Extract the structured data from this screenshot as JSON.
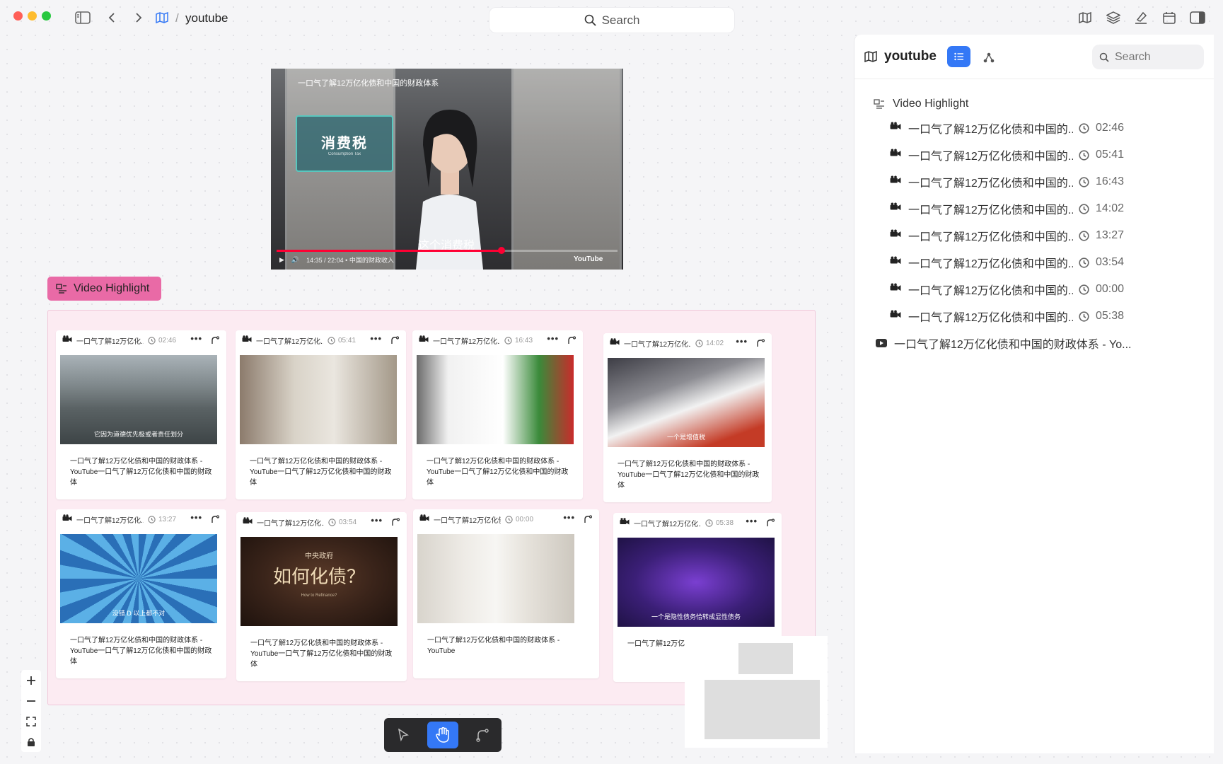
{
  "window": {
    "breadcrumb_sep": "/",
    "title": "youtube",
    "search_placeholder": "Search"
  },
  "panel": {
    "title": "youtube",
    "search_placeholder": "Search",
    "group_label": "Video Highlight",
    "items": [
      {
        "label": "一口气了解12万亿化债和中国的...",
        "time": "02:46"
      },
      {
        "label": "一口气了解12万亿化债和中国的...",
        "time": "05:41"
      },
      {
        "label": "一口气了解12万亿化债和中国的...",
        "time": "16:43"
      },
      {
        "label": "一口气了解12万亿化债和中国的...",
        "time": "14:02"
      },
      {
        "label": "一口气了解12万亿化债和中国的...",
        "time": "13:27"
      },
      {
        "label": "一口气了解12万亿化债和中国的...",
        "time": "03:54"
      },
      {
        "label": "一口气了解12万亿化债和中国的...",
        "time": "00:00"
      },
      {
        "label": "一口气了解12万亿化债和中国的...",
        "time": "05:38"
      }
    ],
    "video_item": "一口气了解12万亿化债和中国的财政体系 - Yo..."
  },
  "player": {
    "title": "一口气了解12万亿化债和中国的财政体系",
    "overlay_big": "消费税",
    "overlay_small": "Consumption Tax",
    "caption": "这个消费税",
    "time_text": "14:35 / 22:04 • 中国的财政收入",
    "progress_fraction": 0.66,
    "brand": "YouTube"
  },
  "section": {
    "label": "Video Highlight"
  },
  "cards": [
    {
      "title": "一口气了解12万亿化...",
      "time": "02:46",
      "caption": "它因为道德优先极或者责任划分",
      "desc": "一口气了解12万亿化债和中国的财政体系 - YouTube一口气了解12万亿化债和中国的财政体"
    },
    {
      "title": "一口气了解12万亿化...",
      "time": "05:41",
      "caption": "",
      "desc": "一口气了解12万亿化债和中国的财政体系 - YouTube一口气了解12万亿化债和中国的财政体"
    },
    {
      "title": "一口气了解12万亿化...",
      "time": "16:43",
      "caption": "",
      "desc": "一口气了解12万亿化债和中国的财政体系 - YouTube一口气了解12万亿化债和中国的财政体"
    },
    {
      "title": "一口气了解12万亿化...",
      "time": "14:02",
      "caption": "一个是增值税",
      "desc": "一口气了解12万亿化债和中国的财政体系 - YouTube一口气了解12万亿化债和中国的财政体"
    },
    {
      "title": "一口气了解12万亿化...",
      "time": "13:27",
      "caption": "没错 D 以上都不对",
      "desc": "一口气了解12万亿化债和中国的财政体系 - YouTube一口气了解12万亿化债和中国的财政体"
    },
    {
      "title": "一口气了解12万亿化...",
      "time": "03:54",
      "caption": "",
      "desc": "一口气了解12万亿化债和中国的财政体系 - YouTube一口气了解12万亿化债和中国的财政体"
    },
    {
      "title": "一口气了解12万亿化债和...",
      "time": "00:00",
      "caption": "",
      "desc": "一口气了解12万亿化债和中国的财政体系 - YouTube"
    },
    {
      "title": "一口气了解12万亿化...",
      "time": "05:38",
      "caption": "一个是隐性债务恰转成显性债务",
      "desc": "一口气了解12万亿化 YouTube"
    }
  ],
  "card5_center_big": "如何化债？",
  "card5_center_top": "中央政府",
  "card5_center_small": "How to Refinance?",
  "colors": {
    "accent": "#3478f6",
    "section_tag": "#e96aa6",
    "section_bg": "#fcebf2"
  }
}
